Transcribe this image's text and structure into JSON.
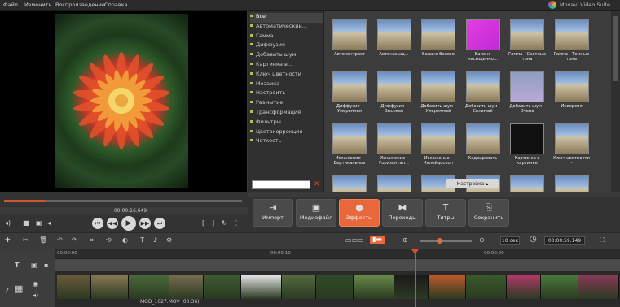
{
  "menu": [
    "Файл",
    "Изменить",
    "Воспроизведение",
    "Справка"
  ],
  "brand": "Movavi Video Suite",
  "effects_categories": [
    {
      "label": "Все",
      "selected": true
    },
    {
      "label": "Автоматический...",
      "selected": false
    },
    {
      "label": "Гамма",
      "selected": false
    },
    {
      "label": "Диффузия",
      "selected": false
    },
    {
      "label": "Добавить шум",
      "selected": false
    },
    {
      "label": "Картинка в...",
      "selected": false
    },
    {
      "label": "Ключ цветности",
      "selected": false
    },
    {
      "label": "Мозаика",
      "selected": false
    },
    {
      "label": "Настроить",
      "selected": false
    },
    {
      "label": "Размытие",
      "selected": false
    },
    {
      "label": "Трансформация",
      "selected": false
    },
    {
      "label": "Фильтры",
      "selected": false
    },
    {
      "label": "Цветокоррекция",
      "selected": false
    },
    {
      "label": "Четкость",
      "selected": false
    }
  ],
  "effects_search": {
    "value": "",
    "placeholder": ""
  },
  "effects": [
    "Автоконтраст",
    "Автонасыщ...",
    "Баланс белого",
    "Баланс насыщенно...",
    "Гамма - Светлые тона",
    "Гамма - Темные тона",
    "Диффузия - Умеренная",
    "Диффузия - Высокая",
    "Добавить шум - Умеренный",
    "Добавить шум - Сильный",
    "Добавить шум - Очень",
    "Инверсия",
    "Искажение - Вертикальное",
    "Искажение - Горизонтал...",
    "Искажение - Калейдоскоп",
    "Кадрировать",
    "Картинка в картинке",
    "Ключ цветности -",
    "",
    "",
    "",
    "",
    "",
    ""
  ],
  "settings_tab": "Настройка",
  "preview_time": "00:00:16.649",
  "seek_progress": 0.17,
  "toolbar": [
    {
      "label": "Импорт",
      "glyph": "⇥",
      "active": false
    },
    {
      "label": "Медиафайл",
      "glyph": "▣",
      "active": false
    },
    {
      "label": "Эффекты",
      "glyph": "●",
      "active": true
    },
    {
      "label": "Переходы",
      "glyph": "⧓",
      "active": false
    },
    {
      "label": "Титры",
      "glyph": "T",
      "active": false
    },
    {
      "label": "Сохранить",
      "glyph": "⎘",
      "active": false
    }
  ],
  "timeline": {
    "seconds_box": "10 сек",
    "time": "00:00:59.149",
    "ruler_ticks": [
      "00:00:00",
      "00:00:10",
      "00:00:20"
    ],
    "clip_label": "MOD_1027.MOV (00:36)"
  },
  "colors": {
    "accent": "#e8673b",
    "playhead": "#e04a2a"
  }
}
